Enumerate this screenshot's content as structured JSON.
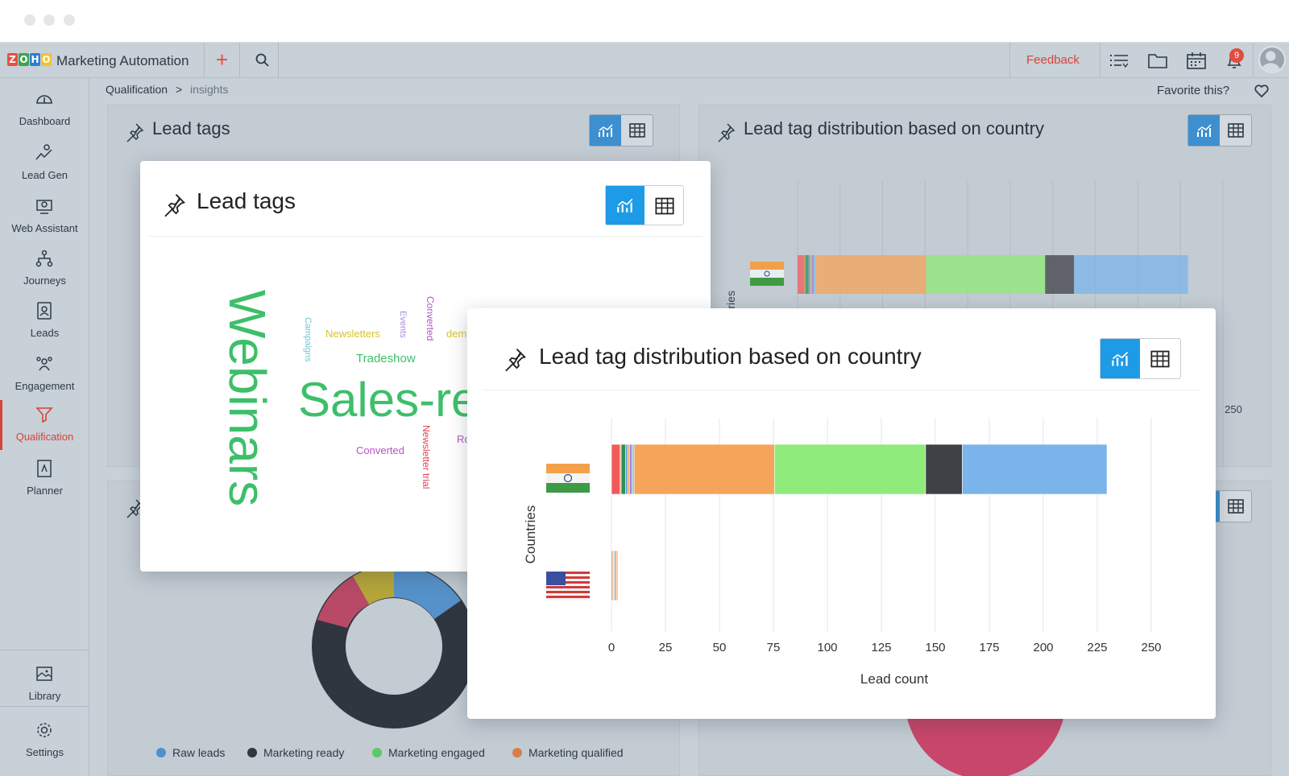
{
  "app": {
    "title": "Marketing Automation",
    "logo_letters": [
      "Z",
      "O",
      "H",
      "O"
    ]
  },
  "topbar": {
    "feedback": "Feedback",
    "notification_count": "9"
  },
  "sidebar": {
    "items": [
      {
        "label": "Dashboard",
        "icon": "dashboard-icon"
      },
      {
        "label": "Lead Gen",
        "icon": "lead-gen-icon"
      },
      {
        "label": "Web Assistant",
        "icon": "web-assistant-icon"
      },
      {
        "label": "Journeys",
        "icon": "journeys-icon"
      },
      {
        "label": "Leads",
        "icon": "leads-icon"
      },
      {
        "label": "Engagement",
        "icon": "engagement-icon"
      },
      {
        "label": "Qualification",
        "icon": "filter-icon",
        "active": true
      },
      {
        "label": "Planner",
        "icon": "planner-icon"
      }
    ],
    "bottom": [
      {
        "label": "Library",
        "icon": "library-icon"
      },
      {
        "label": "Settings",
        "icon": "gear-icon"
      }
    ]
  },
  "breadcrumb": {
    "root": "Qualification",
    "separator": ">",
    "current": "insights"
  },
  "favorite": {
    "label": "Favorite this?"
  },
  "background_cards": {
    "lead_tags": {
      "title": "Lead tags"
    },
    "distribution": {
      "title": "Lead tag distribution based on country",
      "axis_ylabel": "Countries",
      "tick_250": "250"
    }
  },
  "lead_tags_popup": {
    "title": "Lead tags",
    "words": [
      {
        "text": "Webinars",
        "color": "#3dbf6a"
      },
      {
        "text": "Sales-re",
        "color": "#3dbf6a"
      },
      {
        "text": "Campaigns",
        "color": "#6fc7d6"
      },
      {
        "text": "Newsletters",
        "color": "#d7c62a"
      },
      {
        "text": "Events",
        "color": "#a98be0"
      },
      {
        "text": "Converted",
        "color": "#b455c6"
      },
      {
        "text": "dem",
        "color": "#d7c62a"
      },
      {
        "text": "Tradeshow",
        "color": "#3dbf6a"
      },
      {
        "text": "Converted",
        "color": "#b455c6"
      },
      {
        "text": "Newsletter trial",
        "color": "#e2445a"
      },
      {
        "text": "Ro",
        "color": "#b455c6"
      }
    ]
  },
  "distribution_popup": {
    "title": "Lead tag distribution based on country"
  },
  "chart_data": {
    "type": "bar",
    "orientation": "horizontal",
    "stacked": true,
    "title": "Lead tag distribution based on country",
    "xlabel": "Lead count",
    "ylabel": "Countries",
    "categories": [
      "India",
      "United States"
    ],
    "xlim": [
      0,
      250
    ],
    "xticks": [
      "0",
      "25",
      "50",
      "75",
      "100",
      "125",
      "150",
      "175",
      "200",
      "225",
      "250"
    ],
    "grid": true,
    "series": [
      {
        "color": "#ef5b5b",
        "values": [
          4,
          0.5
        ]
      },
      {
        "color": "#f3a05b",
        "values": [
          0.5,
          0
        ]
      },
      {
        "color": "#2f8f57",
        "values": [
          2,
          0
        ]
      },
      {
        "color": "#5a9de0",
        "values": [
          1,
          0
        ]
      },
      {
        "color": "#e7b04f",
        "values": [
          1,
          0.5
        ]
      },
      {
        "color": "#a873d8",
        "values": [
          1,
          0
        ]
      },
      {
        "color": "#7fc4e8",
        "values": [
          1,
          0.5
        ]
      },
      {
        "color": "#f6a45a",
        "values": [
          65,
          1
        ]
      },
      {
        "color": "#8feb7a",
        "values": [
          70,
          0.5
        ]
      },
      {
        "color": "#3f4147",
        "values": [
          17,
          0
        ]
      },
      {
        "color": "#7ab4ea",
        "values": [
          67,
          0
        ]
      }
    ]
  },
  "donut_chart": {
    "legend": [
      {
        "label": "Raw leads",
        "color": "#4f8fd0"
      },
      {
        "label": "Marketing ready",
        "color": "#2f3640"
      },
      {
        "label": "Marketing engaged",
        "color": "#5cc86a"
      },
      {
        "label": "Marketing qualified",
        "color": "#d77f4c"
      }
    ]
  },
  "colors": {
    "accent": "#d4453a",
    "toggle_active": "#1e9be6"
  }
}
